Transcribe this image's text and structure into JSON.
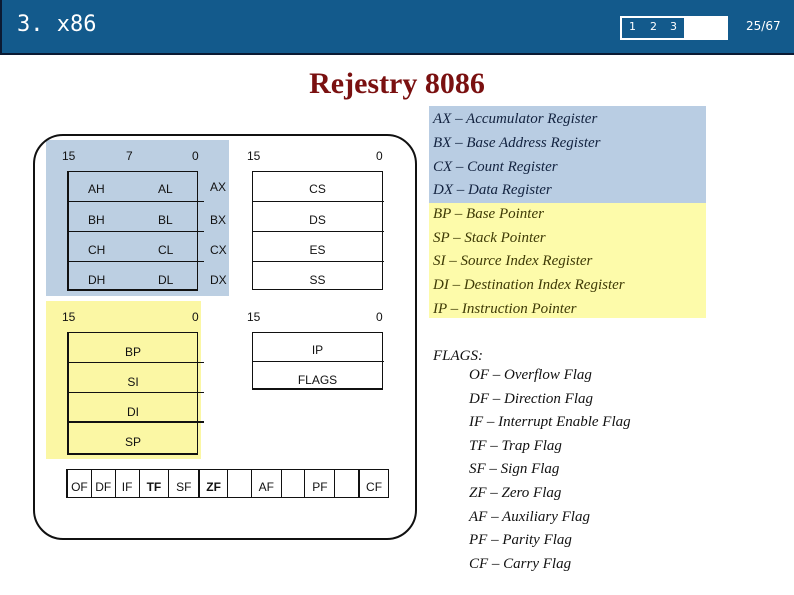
{
  "header": {
    "title": "3. x86",
    "nav": [
      "1",
      "2",
      "3"
    ],
    "page_counter": "25/67",
    "background_color": "#135a8c"
  },
  "slide": {
    "title": "Rejestry 8086",
    "title_color": "#7a1010"
  },
  "diagram": {
    "general": {
      "bit_labels": [
        "15",
        "7",
        "0"
      ],
      "rows": [
        {
          "high": "AH",
          "low": "AL",
          "name": "AX"
        },
        {
          "high": "BH",
          "low": "BL",
          "name": "BX"
        },
        {
          "high": "CH",
          "low": "CL",
          "name": "CX"
        },
        {
          "high": "DH",
          "low": "DL",
          "name": "DX"
        }
      ]
    },
    "segment": {
      "bit_labels": [
        "15",
        "0"
      ],
      "rows": [
        "CS",
        "DS",
        "ES",
        "SS"
      ]
    },
    "pointer_index": {
      "bit_labels": [
        "15",
        "0"
      ],
      "rows": [
        "BP",
        "SI",
        "DI",
        "SP"
      ]
    },
    "ip_flags": {
      "bit_labels": [
        "15",
        "0"
      ],
      "rows": [
        "IP",
        "FLAGS"
      ]
    },
    "flags_register": [
      "OF",
      "DF",
      "IF",
      "TF",
      "SF",
      "ZF",
      "",
      "AF",
      "",
      "PF",
      "",
      "CF"
    ]
  },
  "legend": {
    "registers_blue": [
      "AX – Accumulator Register",
      "BX – Base Address Register",
      "CX – Count Register",
      "DX – Data Register"
    ],
    "registers_yellow": [
      "BP – Base Pointer",
      "SP – Stack Pointer",
      "SI – Source Index Register",
      "DI – Destination Index Register",
      "IP – Instruction Pointer"
    ],
    "flags_heading": "FLAGS:",
    "flags": [
      "OF – Overflow Flag",
      "DF – Direction Flag",
      "IF – Interrupt Enable Flag",
      "TF – Trap Flag",
      "SF – Sign Flag",
      "ZF – Zero Flag",
      "AF – Auxiliary Flag",
      "PF – Parity Flag",
      "CF – Carry Flag"
    ]
  }
}
